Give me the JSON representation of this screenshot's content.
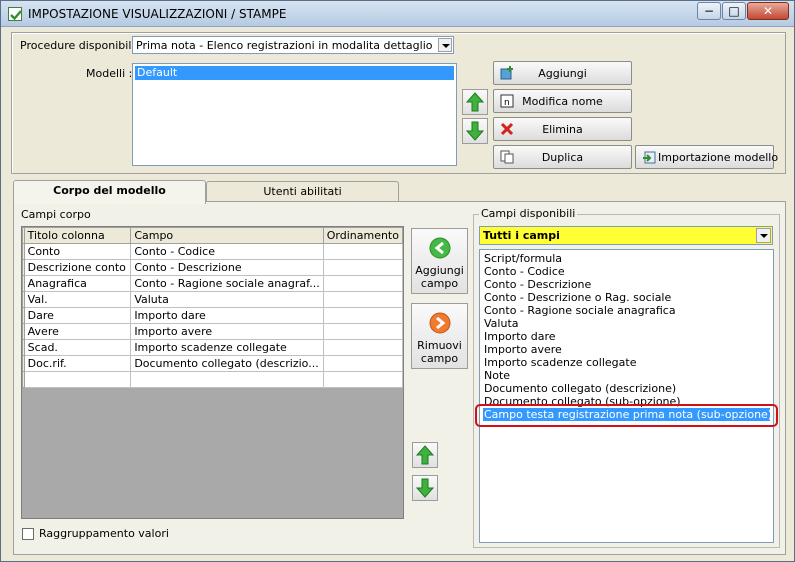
{
  "window": {
    "title": "IMPOSTAZIONE VISUALIZZAZIONI / STAMPE",
    "controls": {
      "minimize": "−",
      "maximize": "□",
      "close": "✕"
    }
  },
  "top": {
    "procedure_label": "Procedure disponibili :",
    "procedure_value": "Prima nota - Elenco registrazioni in modalita dettaglio",
    "models_label": "Modelli :",
    "models": [
      "Default"
    ],
    "buttons": {
      "add": "Aggiungi",
      "rename": "Modifica nome",
      "delete": "Elimina",
      "duplicate": "Duplica",
      "import": "Importazione modello"
    }
  },
  "tabs": [
    {
      "label": "Corpo del modello",
      "active": true
    },
    {
      "label": "Utenti abilitati",
      "active": false
    }
  ],
  "body": {
    "section_label": "Campi corpo",
    "columns": [
      "Titolo colonna",
      "Campo",
      "Ordinamento"
    ],
    "rows": [
      {
        "title": "Conto",
        "field": "Conto - Codice",
        "order": ""
      },
      {
        "title": "Descrizione conto",
        "field": "Conto - Descrizione",
        "order": ""
      },
      {
        "title": "Anagrafica",
        "field": "Conto - Ragione sociale anagraf...",
        "order": ""
      },
      {
        "title": "Val.",
        "field": "Valuta",
        "order": ""
      },
      {
        "title": "Dare",
        "field": "Importo dare",
        "order": ""
      },
      {
        "title": "Avere",
        "field": "Importo avere",
        "order": ""
      },
      {
        "title": "Scad.",
        "field": "Importo scadenze collegate",
        "order": ""
      },
      {
        "title": "Doc.rif.",
        "field": "Documento collegato (descrizio...",
        "order": ""
      },
      {
        "title": "",
        "field": "",
        "order": ""
      }
    ],
    "add_field": "Aggiungi campo",
    "remove_field": "Rimuovi campo",
    "grouping_label": "Raggruppamento valori",
    "grouping_checked": false
  },
  "available": {
    "group_label": "Campi disponibili",
    "filter_value": "Tutti i campi",
    "items": [
      "Script/formula",
      "Conto - Codice",
      "Conto - Descrizione",
      "Conto - Descrizione o Rag. sociale",
      "Conto - Ragione sociale anagrafica",
      "Valuta",
      "Importo dare",
      "Importo avere",
      "Importo scadenze collegate",
      "Note",
      "Documento collegato (descrizione)",
      "Documento collegato (sub-opzione)",
      "Campo testa registrazione prima nota (sub-opzione)"
    ],
    "selected_index": 12
  },
  "colors": {
    "selection": "#3399ff",
    "filter_background": "#ffff33",
    "highlight_ring": "#d0101a"
  }
}
